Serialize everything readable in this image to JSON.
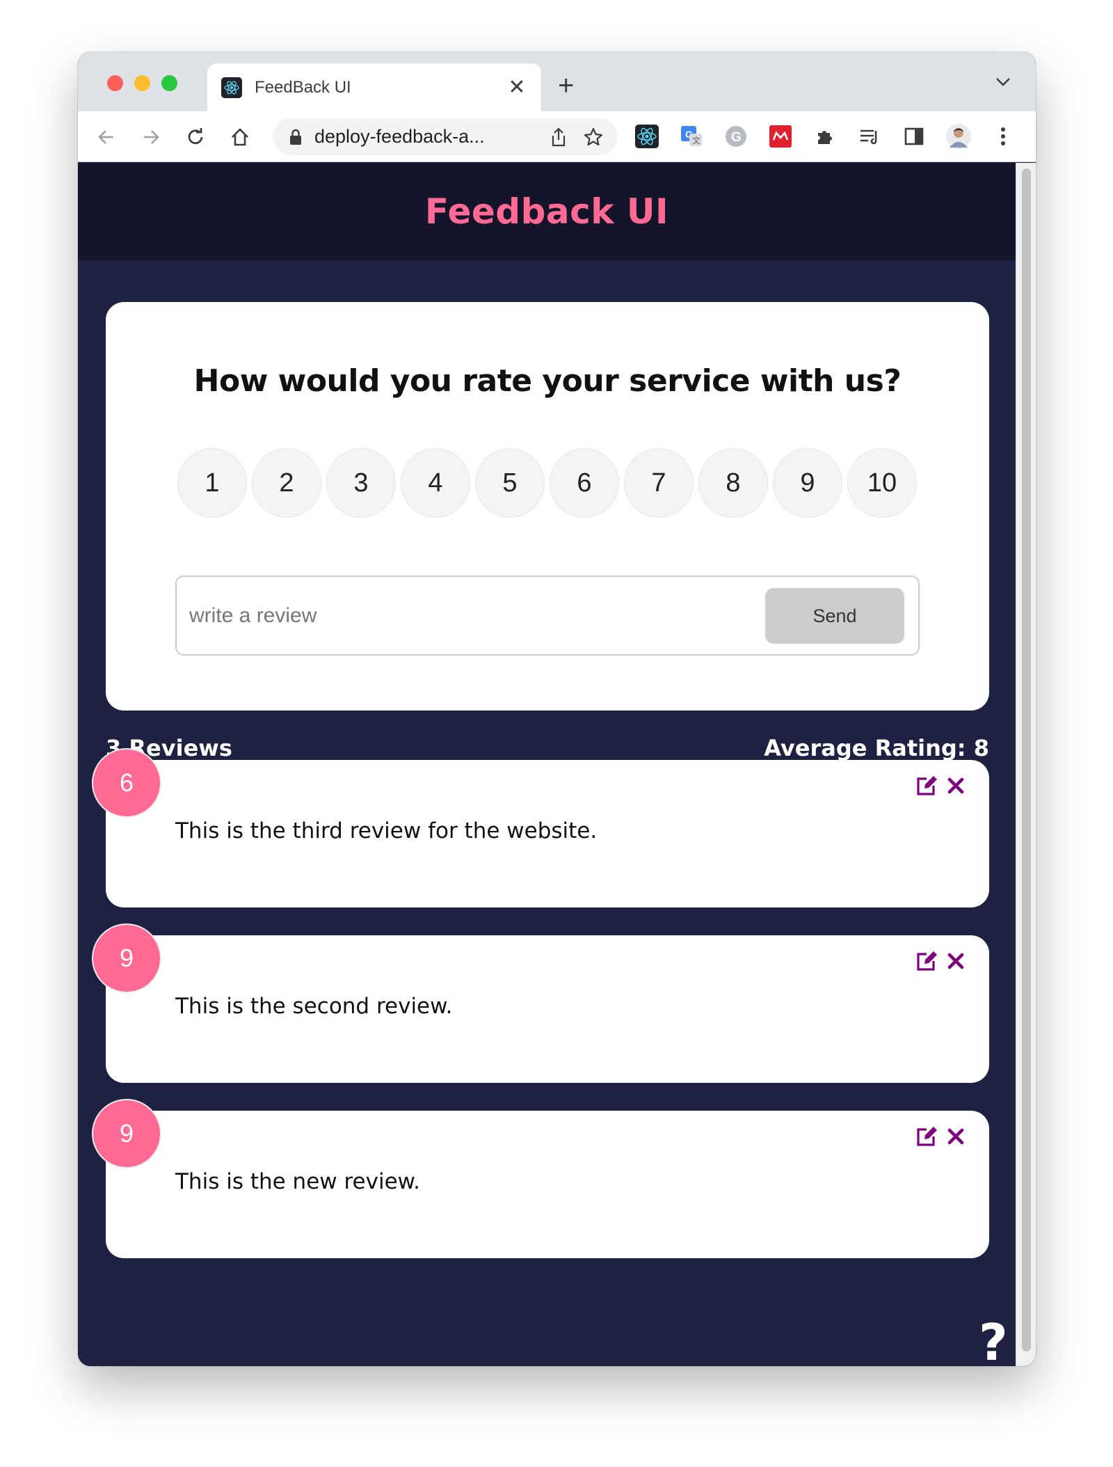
{
  "browser": {
    "tab_title": "FeedBack UI",
    "url": "deploy-feedback-a...",
    "extensions": [
      "react-devtools-icon",
      "google-translate-icon",
      "grammarly-icon",
      "mendeley-icon",
      "extensions-puzzle-icon",
      "reading-list-icon",
      "side-panel-icon",
      "profile-avatar"
    ]
  },
  "app": {
    "title": "Feedback UI",
    "accent_color": "#ff6a95",
    "background_color": "#1f2142"
  },
  "form": {
    "question": "How would you rate your service with us?",
    "ratings": [
      "1",
      "2",
      "3",
      "4",
      "5",
      "6",
      "7",
      "8",
      "9",
      "10"
    ],
    "input_placeholder": "write a review",
    "send_label": "Send"
  },
  "stats": {
    "count_label": "3 Reviews",
    "average_label": "Average Rating: 8"
  },
  "reviews": [
    {
      "rating": "6",
      "text": "This is the third review for the website."
    },
    {
      "rating": "9",
      "text": "This is the second review."
    },
    {
      "rating": "9",
      "text": "This is the new review."
    }
  ],
  "help": {
    "label": "?"
  }
}
